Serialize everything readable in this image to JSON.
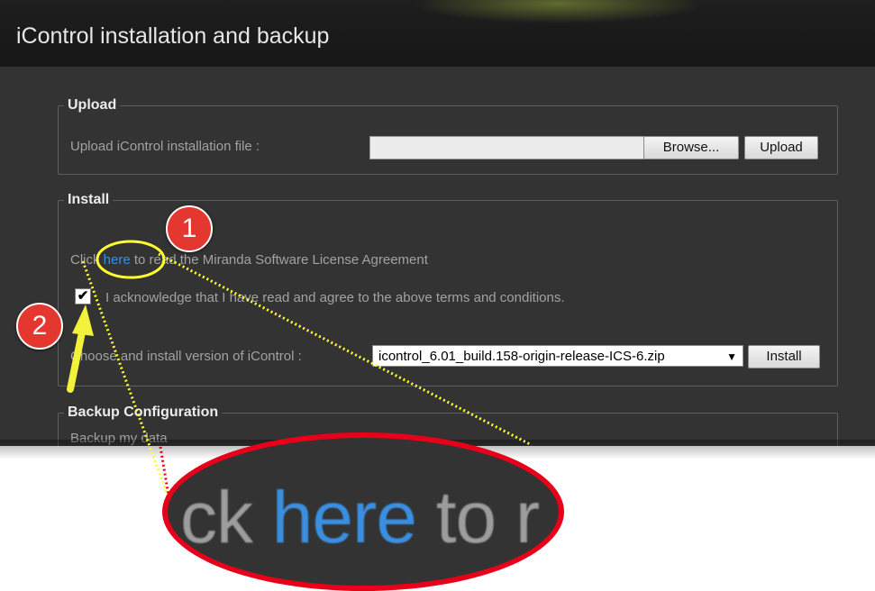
{
  "window": {
    "title": "iControl installation and backup"
  },
  "upload": {
    "legend": "Upload",
    "label": "Upload iControl installation file :",
    "browse_label": "Browse...",
    "upload_label": "Upload"
  },
  "install": {
    "legend": "Install",
    "license_prefix": "Click ",
    "license_link": "here",
    "license_suffix": " to read the Miranda Software License Agreement",
    "checkbox_checked": true,
    "checkbox_label": "I acknowledge that I have read and agree to the above terms and conditions.",
    "version_label": "Choose and install version of iControl :",
    "version_selected": "icontrol_6.01_build.158-origin-release-ICS-6.zip",
    "install_label": "Install"
  },
  "backup": {
    "legend": "Backup Configuration",
    "text": "Backup my data"
  },
  "annotations": {
    "marker_1": "1",
    "marker_2": "2",
    "magnified_prefix": "ck ",
    "magnified_link": "here",
    "magnified_suffix": " to r",
    "colors": {
      "circle": "#e8001a",
      "highlight": "#ffff33",
      "arrow": "#f2f23a",
      "marker": "#e4372f"
    }
  }
}
